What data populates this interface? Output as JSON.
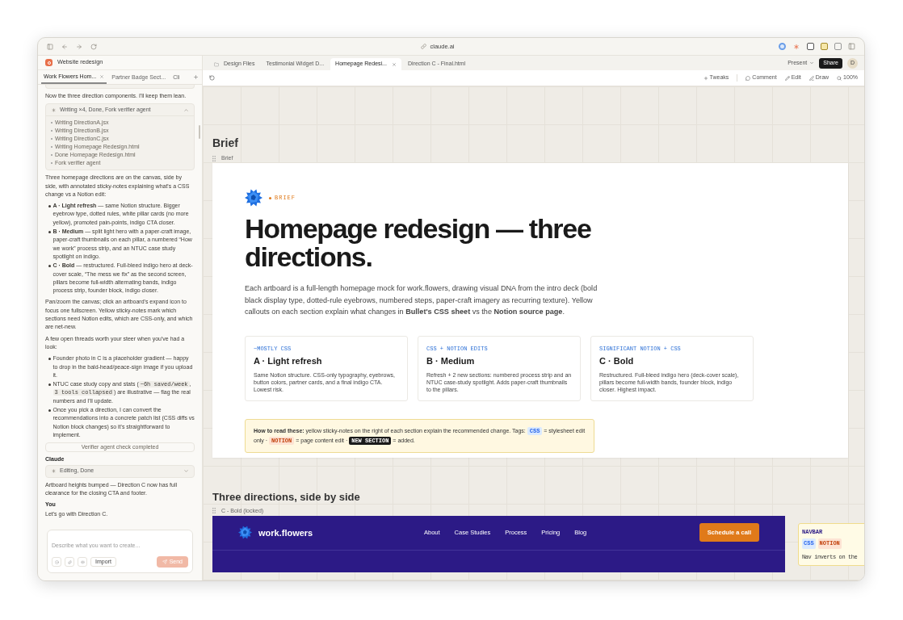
{
  "browser": {
    "address": "claude.ai"
  },
  "project": {
    "title": "Website redesign"
  },
  "chat_tabs": [
    {
      "label": "Work Flowers Hom...",
      "selected": true,
      "closable": true
    },
    {
      "label": "Partner Badge Sect...",
      "selected": false,
      "closable": false
    },
    {
      "label": "Cli",
      "selected": false,
      "closable": false
    }
  ],
  "chat": [
    {
      "kind": "text",
      "text": "Now the three direction components. I'll keep them lean."
    },
    {
      "kind": "tool_group",
      "title": "Writing ×4, Done, Fork verifier agent",
      "expanded": true,
      "steps": [
        "Writing DirectionA.jsx",
        "Writing DirectionB.jsx",
        "Writing DirectionC.jsx",
        "Writing Homepage Redesign.html",
        "Done Homepage Redesign.html",
        "Fork verifier agent"
      ]
    },
    {
      "kind": "text",
      "text": "Three homepage directions are on the canvas, side by side, with annotated sticky-notes explaining what's a CSS change vs a Notion edit:"
    },
    {
      "kind": "bullets",
      "items": [
        [
          {
            "kind": "text",
            "text": "**A · Light refresh** — same Notion structure. Bigger eyebrow type, dotted rules, white pillar cards (no more yellow), promoted pain-points, indigo CTA closer."
          }
        ],
        [
          {
            "kind": "text",
            "text": "**B · Medium** — split light hero with a paper-craft image, paper-craft thumbnails on each pillar, a numbered “How we work” process strip, and an NTUC case study spotlight on indigo."
          }
        ],
        [
          {
            "kind": "text",
            "text": "**C · Bold** — restructured. Full-bleed indigo hero at deck-cover scale, “The mess we fix” as the second screen, pillars become full-width alternating bands, indigo process strip, founder block, indigo closer."
          }
        ]
      ]
    },
    {
      "kind": "text",
      "text": "Pan/zoom the canvas; click an artboard's expand icon to focus one fullscreen. Yellow sticky-notes mark which sections need Notion edits, which are CSS-only, and which are net-new."
    },
    {
      "kind": "text",
      "text": "A few open threads worth your steer when you've had a look:"
    },
    {
      "kind": "bullets",
      "items": [
        [
          {
            "kind": "text",
            "text": "Founder photo in C is a placeholder gradient — happy to drop in the bald-head/peace-sign image if you upload it."
          }
        ],
        [
          {
            "kind": "text",
            "text": "NTUC case study copy and stats ("
          },
          {
            "kind": "code",
            "text": "~6h saved/week"
          },
          {
            "kind": "text",
            "text": ", "
          },
          {
            "kind": "code",
            "text": "3 tools collapsed"
          },
          {
            "kind": "text",
            "text": ") are illustrative — flag the real numbers and I'll update."
          }
        ],
        [
          {
            "kind": "text",
            "text": "Once you pick a direction, I can convert the recommendations into a concrete patch list (CSS diffs vs Notion block changes) so it's straightforward to implement."
          }
        ]
      ]
    },
    {
      "kind": "status",
      "text": "Verifier agent check completed"
    },
    {
      "kind": "speaker",
      "text": "Claude"
    },
    {
      "kind": "tool_group",
      "title": "Editing, Done",
      "expanded": false
    },
    {
      "kind": "text",
      "text": "Artboard heights bumped — Direction C now has full clearance for the closing CTA and footer."
    },
    {
      "kind": "speaker",
      "text": "You"
    },
    {
      "kind": "text",
      "text": "Let's go with Direction C."
    }
  ],
  "composer": {
    "placeholder": "Describe what you want to create...",
    "import": "Import",
    "send": "Send",
    "send_disabled": true
  },
  "file_tabs": [
    {
      "label": "Design Files",
      "selected": false,
      "closable": false
    },
    {
      "label": "Testimonial Widget D...",
      "selected": false,
      "closable": false
    },
    {
      "label": "Homepage Redesi...",
      "selected": true,
      "closable": true
    },
    {
      "label": "Direction C - Final.html",
      "selected": false,
      "closable": false
    }
  ],
  "header_actions": {
    "present": "Present",
    "share": "Share",
    "avatar": "D"
  },
  "toolbar": [
    {
      "kind": "tweaks",
      "label": "Tweaks"
    },
    {
      "kind": "comment",
      "label": "Comment"
    },
    {
      "kind": "edit",
      "label": "Edit"
    },
    {
      "kind": "draw",
      "label": "Draw"
    },
    {
      "kind": "zoom",
      "label": "100%"
    }
  ],
  "brief": {
    "heading": "Brief",
    "artboard_label": "Brief",
    "eyebrow": "BRIEF",
    "title": "Homepage redesign — three directions.",
    "lead": "Each artboard is a full-length homepage mock for work.flowers, drawing visual DNA from the intro deck (bold black display type, dotted-rule eyebrows, numbered steps, paper-craft imagery as recurring texture). Yellow callouts on each section explain what changes in **Bullet's CSS sheet** vs the **Notion source page**.",
    "cards": [
      {
        "tag": "~MOSTLY CSS",
        "title": "A · Light refresh",
        "body": "Same Notion structure. CSS-only typography, eyebrows, button colors, partner cards, and a final indigo CTA. Lowest risk."
      },
      {
        "tag": "CSS + NOTION EDITS",
        "title": "B · Medium",
        "body": "Refresh + 2 new sections: numbered process strip and an NTUC case-study spotlight. Adds paper-craft thumbnails to the pillars."
      },
      {
        "tag": "SIGNIFICANT NOTION + CSS",
        "title": "C · Bold",
        "body": "Restructured. Full-bleed indigo hero (deck-cover scale), pillars become full-width bands, founder block, indigo closer. Highest impact."
      }
    ],
    "callout": [
      {
        "kind": "text",
        "text": "**How to read these:** yellow sticky-notes on the right of each section explain the recommended change. Tags: "
      },
      {
        "kind": "css",
        "text": "CSS"
      },
      {
        "kind": "text",
        "text": " = stylesheet edit only · "
      },
      {
        "kind": "notion",
        "text": "NOTION"
      },
      {
        "kind": "text",
        "text": " = page content edit · "
      },
      {
        "kind": "new",
        "text": "NEW SECTION"
      },
      {
        "kind": "text",
        "text": " = added."
      }
    ]
  },
  "directions": {
    "heading": "Three directions, side by side",
    "artboard_label": "C - Bold (locked)",
    "navbar": {
      "brand": "work.flowers",
      "links": [
        "About",
        "Case Studies",
        "Process",
        "Pricing",
        "Blog"
      ],
      "cta": "Schedule a call"
    },
    "sticky": {
      "title": "NAVBAR",
      "tags": [
        {
          "kind": "css",
          "label": "CSS"
        },
        {
          "kind": "notion",
          "label": "NOTION"
        }
      ],
      "text": "Nav inverts on the"
    }
  }
}
